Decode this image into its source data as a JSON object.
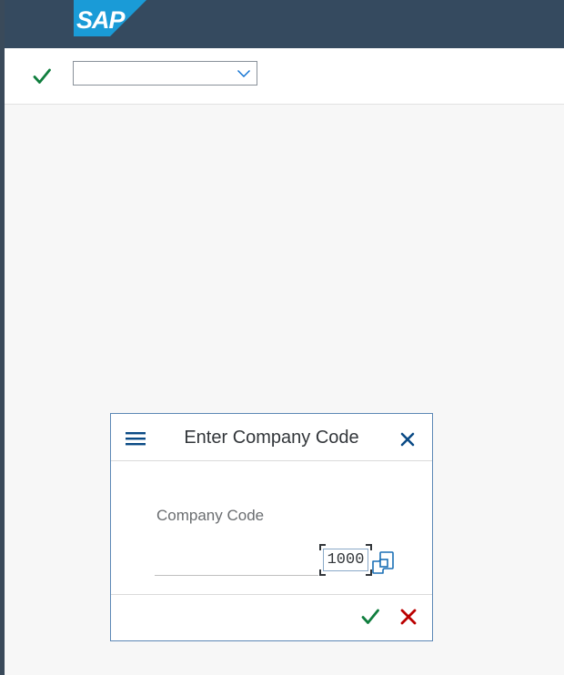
{
  "header": {
    "logo_text": "SAP",
    "logo_color": "#1a9bd7",
    "background_color": "#354a5f"
  },
  "toolbar": {
    "enter_icon": "checkmark-icon",
    "command_field_value": "",
    "command_dropdown_icon": "chevron-down-icon"
  },
  "dialog": {
    "title": "Enter Company Code",
    "menu_icon": "hamburger-menu-icon",
    "close_icon": "close-icon",
    "fields": [
      {
        "label": "Company Code",
        "value": "1000",
        "value_help_icon": "value-help-icon"
      }
    ],
    "footer": {
      "ok_icon": "checkmark-icon",
      "ok_color": "#107e3e",
      "cancel_icon": "close-icon",
      "cancel_color": "#bb0000"
    }
  }
}
